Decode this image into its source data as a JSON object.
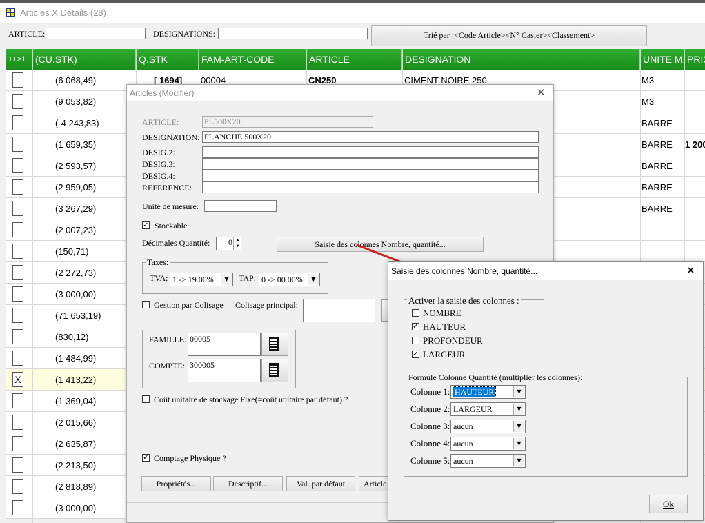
{
  "window": {
    "title": "Articles X Détails (28)"
  },
  "search": {
    "article_label": "ARTICLE:",
    "article_value": "",
    "designations_label": "DESIGNATIONS:",
    "designations_value": "",
    "sort_button": "Trié par :<Code Article><N° Casier><Classement>"
  },
  "grid": {
    "columns": [
      "++>1",
      "(CU.STK)",
      "Q.STK",
      "FAM-ART-CODE",
      "ARTICLE",
      "DESIGNATION",
      "UNITE M.",
      "PRIX"
    ],
    "rows": [
      {
        "check": "",
        "cu": "(6 068,49)",
        "qstk": "[ 1694]",
        "fam": "00004",
        "article": "CN250",
        "designation": "CIMENT NOIRE 250",
        "unite": "M3",
        "prix": ""
      },
      {
        "check": "",
        "cu": "(9 053,82)",
        "unite": "M3",
        "prix": ""
      },
      {
        "check": "",
        "cu": "(-4 243,83)",
        "unite": "BARRE",
        "prix": ""
      },
      {
        "check": "",
        "cu": "(1 659,35)",
        "unite": "BARRE",
        "prix": "1 200"
      },
      {
        "check": "",
        "cu": "(2 593,57)",
        "unite": "BARRE",
        "prix": ""
      },
      {
        "check": "",
        "cu": "(2 959,05)",
        "unite": "BARRE",
        "prix": ""
      },
      {
        "check": "",
        "cu": "(3 267,29)",
        "unite": "BARRE",
        "prix": ""
      },
      {
        "check": "",
        "cu": "(2 007,23)",
        "unite": "",
        "prix": ""
      },
      {
        "check": "",
        "cu": "(150,71)",
        "unite": "",
        "prix": ""
      },
      {
        "check": "",
        "cu": "(2 272,73)",
        "unite": "",
        "prix": ""
      },
      {
        "check": "",
        "cu": "(3 000,00)",
        "unite": "",
        "prix": ""
      },
      {
        "check": "",
        "cu": "(71 653,19)",
        "unite": "",
        "prix": ""
      },
      {
        "check": "",
        "cu": "(830,12)",
        "unite": "",
        "prix": ""
      },
      {
        "check": "",
        "cu": "(1 484,99)",
        "unite": "",
        "prix": ""
      },
      {
        "check": "X",
        "cu": "(1 413,22)",
        "unite": "",
        "prix": ""
      },
      {
        "check": "",
        "cu": "(1 369,04)",
        "unite": "",
        "prix": ""
      },
      {
        "check": "",
        "cu": "(2 015,66)",
        "unite": "",
        "prix": ""
      },
      {
        "check": "",
        "cu": "(2 635,87)",
        "unite": "",
        "prix": ""
      },
      {
        "check": "",
        "cu": "(2 213,50)",
        "unite": "",
        "prix": ""
      },
      {
        "check": "",
        "cu": "(2 818,89)",
        "unite": "",
        "prix": ""
      },
      {
        "check": "",
        "cu": "(3 000,00)",
        "unite": "",
        "prix": ""
      }
    ]
  },
  "modify_dialog": {
    "title": "Articles  (Modifier)",
    "close": "✕",
    "article_label": "ARTICLE:",
    "article_value": "PL500X20",
    "designation_label": "DESIGNATION:",
    "designation_value": "PLANCHE 500X20",
    "desig2_label": "DESIG.2:",
    "desig3_label": "DESIG.3:",
    "desig4_label": "DESIG.4:",
    "reference_label": "REFERENCE:",
    "unite_label": "Unité de mesure:",
    "stockable_label": "Stockable",
    "decimales_label": "Décimales Quantité:",
    "decimales_value": "0",
    "saisie_button": "Saisie des colonnes Nombre, quantité...",
    "taxes_label": "Taxes:",
    "tva_label": "TVA:",
    "tva_value": "1 -> 19.00%",
    "tap_label": "TAP:",
    "tap_value": "0 -> 00.00%",
    "colisage_label": "Gestion par Colisage",
    "colisage_principal_label": "Colisage principal:",
    "famille_label": "FAMILLE:",
    "famille_value": "00005",
    "compte_label": "COMPTE:",
    "compte_value": "300005",
    "cout_label": "Coût unitaire de stockage Fixe(=coût unitaire par défaut) ?",
    "comptage_label": "Comptage Physique ?",
    "btn_proprietes": "Propriétés...",
    "btn_descriptif": "Descriptif...",
    "btn_valdefaut": "Val. par défaut",
    "btn_article": "Article"
  },
  "saisie_dialog": {
    "title": "Saisie des colonnes Nombre, quantité...",
    "close": "✕",
    "activer_label": "Activer la saisie des colonnes :",
    "options": [
      {
        "label": "NOMBRE",
        "checked": false
      },
      {
        "label": "HAUTEUR",
        "checked": true
      },
      {
        "label": "PROFONDEUR",
        "checked": false
      },
      {
        "label": "LARGEUR",
        "checked": true
      }
    ],
    "formule_label": "Formule Colonne Quantité (multiplier les colonnes):",
    "colonnes": [
      {
        "label": "Colonne 1:",
        "value": "HAUTEUR"
      },
      {
        "label": "Colonne 2:",
        "value": "LARGEUR"
      },
      {
        "label": "Colonne 3:",
        "value": "aucun"
      },
      {
        "label": "Colonne 4:",
        "value": "aucun"
      },
      {
        "label": "Colonne 5:",
        "value": "aucun"
      }
    ],
    "ok_button": "Ok"
  },
  "colors": {
    "header_green": "#2e9e2e",
    "highlight_row": "#ffffe0",
    "arrow": "#d42020",
    "selection": "#0078d7"
  }
}
